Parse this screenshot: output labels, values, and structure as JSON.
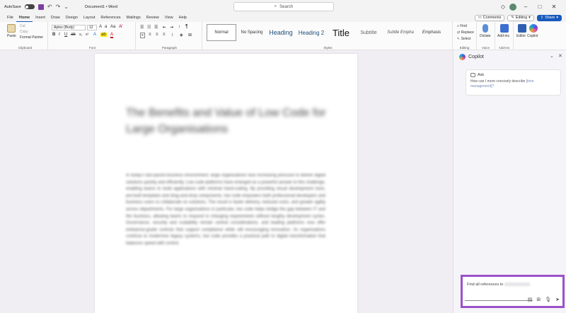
{
  "titlebar": {
    "autosave": "AutoSave",
    "autosave_state": "Off",
    "doc_title": "Document1 • Word",
    "search_placeholder": "Search"
  },
  "menu": {
    "tabs": [
      "File",
      "Home",
      "Insert",
      "Draw",
      "Design",
      "Layout",
      "References",
      "Mailings",
      "Review",
      "View",
      "Help"
    ],
    "active_tab": "Home",
    "comments": "Comments",
    "editing": "Editing",
    "share": "Share"
  },
  "ribbon": {
    "clipboard": {
      "paste": "Paste",
      "cut": "Cut",
      "copy": "Copy",
      "format_painter": "Format Painter",
      "label": "Clipboard"
    },
    "font": {
      "name": "Aptos (Body)",
      "size": "12",
      "label": "Font"
    },
    "paragraph": {
      "label": "Paragraph"
    },
    "styles": {
      "items": [
        "Normal",
        "No Spacing",
        "Heading",
        "Heading 2",
        "Title",
        "Subtitle",
        "Subtle Empha",
        "Emphasis"
      ],
      "label": "Styles"
    },
    "editing": {
      "find": "Find",
      "replace": "Replace",
      "select": "Select",
      "label": "Editing"
    },
    "voice": {
      "dictate": "Dictate",
      "label": "Voice"
    },
    "addins": {
      "addins": "Add-ins",
      "label": "Add-ins"
    },
    "editor": "Editor",
    "copilot": "Copilot"
  },
  "document": {
    "title": "The Benefits and Value of Low Code for Large Organisations",
    "body": "In today's fast-paced business environment, large organisations face increasing pressure to deliver digital solutions quickly and efficiently. Low code platforms have emerged as a powerful answer to this challenge, enabling teams to build applications with minimal hand-coding. By providing visual development tools, pre-built templates and drag-and-drop components, low code empowers both professional developers and business users to collaborate on solutions. The result is faster delivery, reduced costs, and greater agility across departments. For large organisations in particular, low code helps bridge the gap between IT and the business, allowing teams to respond to changing requirements without lengthy development cycles. Governance, security and scalability remain central considerations, and leading platforms now offer enterprise-grade controls that support compliance while still encouraging innovation. As organisations continue to modernise legacy systems, low code provides a practical path to digital transformation that balances speed with control."
  },
  "copilot": {
    "title": "Copilot",
    "ask_label": "Ask",
    "ask_prompt_prefix": "How can I more concisely describe",
    "ask_prompt_highlight": "[time management]?",
    "input_text": "Find all references to"
  }
}
